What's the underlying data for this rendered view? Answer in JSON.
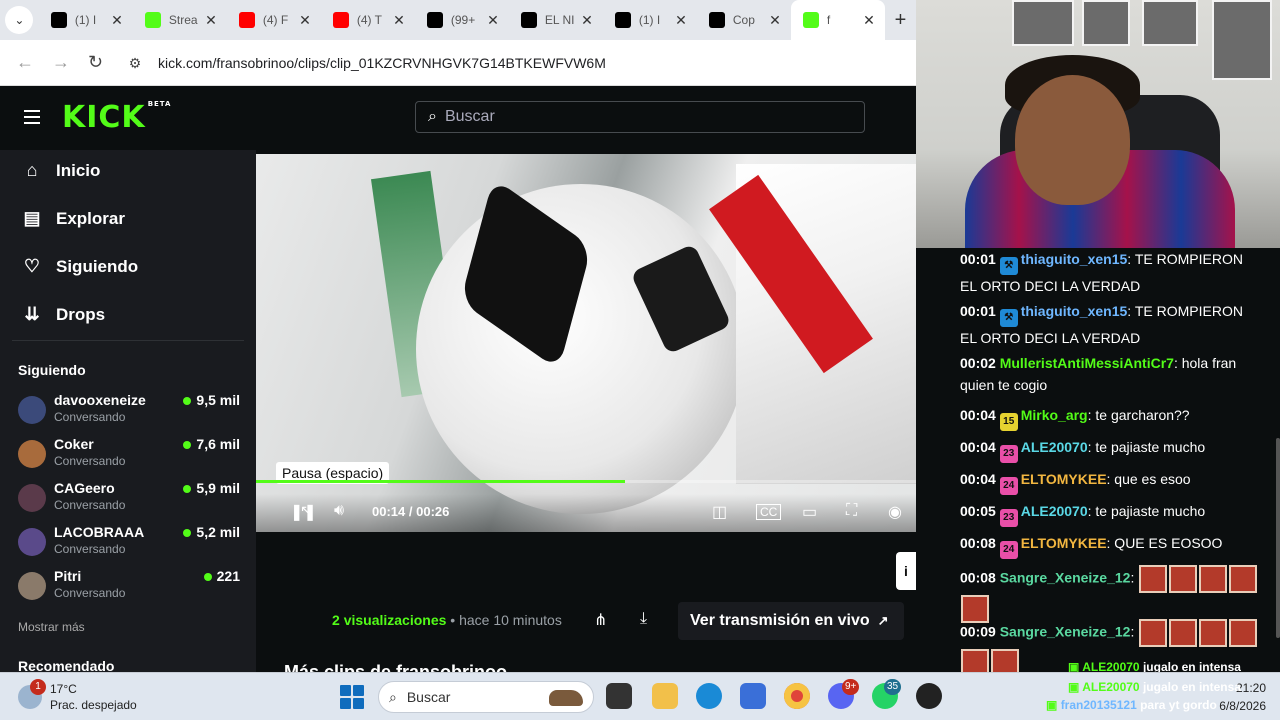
{
  "browser": {
    "tabs": [
      {
        "label": "(1) I",
        "icon": "x-icon",
        "color": "#000000"
      },
      {
        "label": "Strea",
        "icon": "kick-icon",
        "color": "#53fc18"
      },
      {
        "label": "(4) F",
        "icon": "youtube-icon",
        "color": "#ff0000"
      },
      {
        "label": "(4) T",
        "icon": "youtube-icon",
        "color": "#ff0000"
      },
      {
        "label": "(99+",
        "icon": "tiktok-icon",
        "color": "#000000"
      },
      {
        "label": "EL NI",
        "icon": "news-icon",
        "color": "#000000"
      },
      {
        "label": "(1) I",
        "icon": "x-icon",
        "color": "#000000"
      },
      {
        "label": "Cop",
        "icon": "copilot-icon",
        "color": "#000000"
      },
      {
        "label": "f",
        "icon": "kick-icon",
        "color": "#53fc18"
      }
    ],
    "url": "kick.com/fransobrinoo/clips/clip_01KZCRVNHGVK7G14BTKEWFVW6M"
  },
  "kick": {
    "logo": "KICK",
    "logo_badge": "BETA",
    "search_placeholder": "Buscar",
    "nav": [
      {
        "label": "Inicio",
        "icon": "home-icon"
      },
      {
        "label": "Explorar",
        "icon": "browse-icon"
      },
      {
        "label": "Siguiendo",
        "icon": "heart-icon"
      },
      {
        "label": "Drops",
        "icon": "drops-icon"
      }
    ],
    "following_title": "Siguiendo",
    "following": [
      {
        "name": "davooxeneize",
        "status": "Conversando",
        "viewers": "9,5 mil"
      },
      {
        "name": "Coker",
        "status": "Conversando",
        "viewers": "7,6 mil"
      },
      {
        "name": "CAGeero",
        "status": "Conversando",
        "viewers": "5,9 mil"
      },
      {
        "name": "LACOBRAAA",
        "status": "Conversando",
        "viewers": "5,2 mil"
      },
      {
        "name": "Pitri",
        "status": "Conversando",
        "viewers": "221"
      }
    ],
    "show_more": "Mostrar más",
    "recommended_title": "Recomendado"
  },
  "player": {
    "tooltip": "Pausa (espacio)",
    "current_time": "00:14",
    "separator": "/",
    "duration": "00:26",
    "progress_fraction": 0.54
  },
  "clip": {
    "views_count": "2",
    "views_label": "visualizaciones",
    "dot": "•",
    "age": "hace 10 minutos",
    "live_button": "Ver transmisión en vivo",
    "more_clips": "Más clips de fransobrinoo"
  },
  "chat": [
    {
      "time": "00:01",
      "user": "thiaguito_xen15",
      "color": "#6fb7ff",
      "text": ": TE ROMPIERON EL ORTO DECI LA VERDAD",
      "badge": "⚒",
      "badge_color": "#1f8ad6"
    },
    {
      "time": "00:01",
      "user": "thiaguito_xen15",
      "color": "#6fb7ff",
      "text": ": TE ROMPIERON EL ORTO DECI LA VERDAD",
      "badge": "⚒",
      "badge_color": "#1f8ad6"
    },
    {
      "time": "00:02",
      "user": "MulleristAntiMessiAntiCr7",
      "color": "#53fc18",
      "text": ": hola fran quien te cogio",
      "badge": "",
      "badge_color": ""
    },
    {
      "time": "00:04",
      "user": "Mirko_arg",
      "color": "#53fc18",
      "text": ": te garcharon??",
      "badge": "15",
      "badge_color": "#e6d230"
    },
    {
      "time": "00:04",
      "user": "ALE20070",
      "color": "#5ad8e6",
      "text": ": te pajiaste mucho",
      "badge": "23",
      "badge_color": "#e94fa8"
    },
    {
      "time": "00:04",
      "user": "ELTOMYKEE",
      "color": "#f2b640",
      "text": ": que es esoo",
      "badge": "24",
      "badge_color": "#e94fa8"
    },
    {
      "time": "00:05",
      "user": "ALE20070",
      "color": "#5ad8e6",
      "text": ": te pajiaste mucho",
      "badge": "23",
      "badge_color": "#e94fa8"
    },
    {
      "time": "00:08",
      "user": "ELTOMYKEE",
      "color": "#f2b640",
      "text": ": QUE ES EOSOO",
      "badge": "24",
      "badge_color": "#e94fa8"
    },
    {
      "time": "00:08",
      "user": "Sangre_Xeneize_12",
      "color": "#5ad8a0",
      "text": ":",
      "badge": "",
      "badge_color": ""
    },
    {
      "time": "00:09",
      "user": "Sangre_Xeneize_12",
      "color": "#5ad8a0",
      "text": ":",
      "badge": "",
      "badge_color": ""
    }
  ],
  "overlay_chat": [
    {
      "user": "ALE20070",
      "text": "jugalo en intensa"
    },
    {
      "user": "ALE20070",
      "text": "jugalo en intensa"
    },
    {
      "user": "fran20135121",
      "text": "para yt gordo"
    }
  ],
  "taskbar": {
    "weather_temp": "17°C",
    "weather_desc": "Prac. despejado",
    "weather_badge": "1",
    "search_placeholder": "Buscar",
    "discord_badge": "9+",
    "whatsapp_badge": "35",
    "time": "21:20",
    "date": "6/8/2026"
  },
  "colors": {
    "kick_green": "#53fc18"
  }
}
